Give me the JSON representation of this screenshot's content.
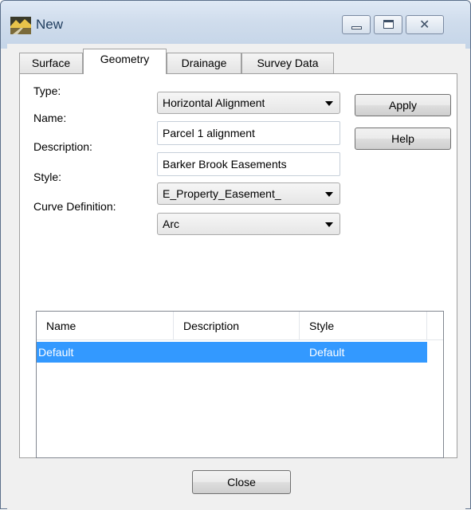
{
  "window": {
    "title": "New",
    "icon": "app-icon"
  },
  "tabs": [
    {
      "label": "Surface",
      "active": false
    },
    {
      "label": "Geometry",
      "active": true
    },
    {
      "label": "Drainage",
      "active": false
    },
    {
      "label": "Survey Data",
      "active": false
    }
  ],
  "form": {
    "type_label": "Type:",
    "type_value": "Horizontal Alignment",
    "name_label": "Name:",
    "name_value": "Parcel 1 alignment",
    "description_label": "Description:",
    "description_value": "Barker Brook Easements",
    "style_label": "Style:",
    "style_value": "E_Property_Easement_",
    "curve_label": "Curve Definition:",
    "curve_value": "Arc"
  },
  "buttons": {
    "apply": "Apply",
    "help": "Help",
    "close": "Close"
  },
  "list": {
    "columns": [
      "Name",
      "Description",
      "Style"
    ],
    "rows": [
      {
        "name": "Default",
        "description": "",
        "style": "Default",
        "selected": true
      }
    ]
  },
  "colors": {
    "selection": "#3399ff",
    "titlebar": "#cfdcec"
  }
}
